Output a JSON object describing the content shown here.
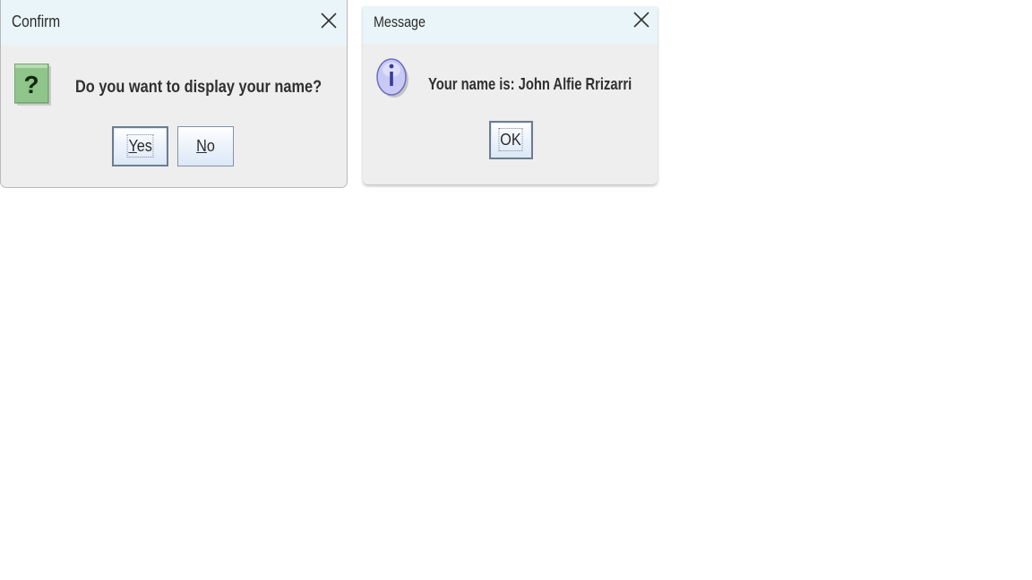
{
  "confirm": {
    "title": "Confirm",
    "message": "Do you want to display your name?",
    "icon": "question-icon",
    "yes_label_mnemonic": "Y",
    "yes_label_rest": "es",
    "no_label_mnemonic": "N",
    "no_label_rest": "o",
    "icon_color": "#8fc48a"
  },
  "message_dialog": {
    "title": "Message",
    "message": "Your name is: John Alfie Rrizarri",
    "icon": "info-icon",
    "ok_label": "OK",
    "icon_color": "#c9c9f5"
  },
  "colors": {
    "title_bar": "#e9f5f8",
    "dialog_bg": "#eeeeee",
    "button_border": "#6c7d90"
  }
}
